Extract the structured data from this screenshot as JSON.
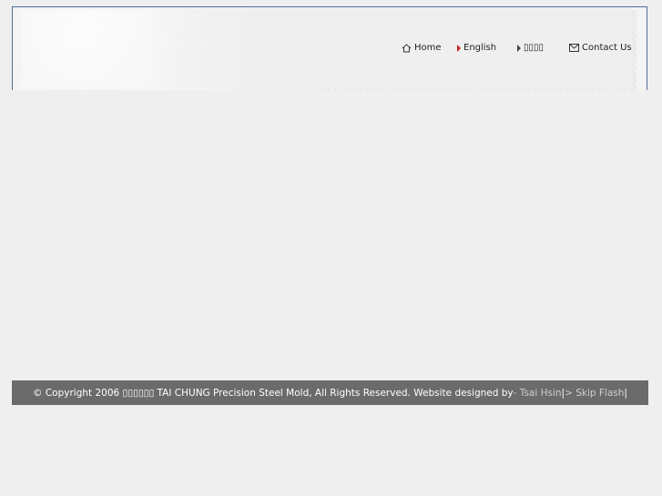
{
  "nav": {
    "home": "Home",
    "english": "English",
    "chinese": "▯▯▯▯",
    "contact": "Contact Us"
  },
  "footer": {
    "copyright": "© Copyright 2006 ▯▯▯▯▯▯ TAI CHUNG Precision Steel Mold, All Rights Reserved. Website designed by ",
    "designer_link": "- Tsai Hsin",
    "separator1": " | ",
    "skip_link": "> Skip Flash",
    "separator2": " |"
  },
  "colors": {
    "nav_arrow": "#cc1f1f",
    "footer_bg": "#6b6b6b",
    "header_border": "#4f6f98"
  }
}
